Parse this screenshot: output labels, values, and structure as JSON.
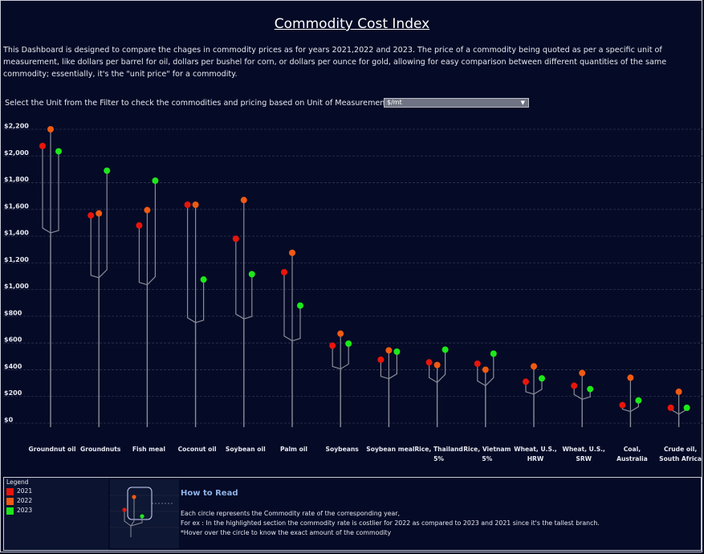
{
  "page": {
    "title": "Commodity Cost Index",
    "description": "This Dashboard is designed to compare the chages in commodity prices as for years  2021,2022 and 2023. The price of a commodity being quoted as per a specific unit of measurement, like dollars per barrel for oil, dollars per bushel for corn, or dollars per ounce for gold, allowing for easy comparison between different quantities of the same commodity; essentially, it's the \"unit price\" for a commodity.",
    "filter_label": "Select the Unit from the Filter to check the commodities and pricing based on Unit of Measurement",
    "unit_filter": {
      "selected": "$/mt"
    }
  },
  "colors": {
    "2021": "#e8150b",
    "2022": "#f05a12",
    "2023": "#1de81a",
    "branch": "#8a8d98",
    "grid": "#2f3550",
    "background": "#050a26"
  },
  "chart_data": {
    "type": "scatter",
    "categories": [
      "Groundnut oil",
      "Groundnuts",
      "Fish meal",
      "Coconut oil",
      "Soybean oil",
      "Palm oil",
      "Soybeans",
      "Soybean meal",
      "Rice, Thailand 5%",
      "Rice, Vietnam 5%",
      "Wheat, U.S., HRW",
      "Wheat, U.S., SRW",
      "Coal, Australia",
      "Crude oil, South Africa"
    ],
    "category_lines": [
      [
        "Groundnut oil"
      ],
      [
        "Groundnuts"
      ],
      [
        "Fish meal"
      ],
      [
        "Coconut oil"
      ],
      [
        "Soybean oil"
      ],
      [
        "Palm oil"
      ],
      [
        "Soybeans"
      ],
      [
        "Soybean meal"
      ],
      [
        "Rice, Thailand",
        "5%"
      ],
      [
        "Rice, Vietnam",
        "5%"
      ],
      [
        "Wheat, U.S.,",
        "HRW"
      ],
      [
        "Wheat, U.S.,",
        "SRW"
      ],
      [
        "Coal,",
        "Australia"
      ],
      [
        "Crude oil,",
        "South Africa"
      ]
    ],
    "series": [
      {
        "name": "2021",
        "values": [
          2075,
          1555,
          1480,
          1635,
          1380,
          1130,
          580,
          475,
          455,
          445,
          310,
          280,
          135,
          115
        ]
      },
      {
        "name": "2022",
        "values": [
          2200,
          1570,
          1595,
          1635,
          1670,
          1275,
          670,
          545,
          435,
          400,
          425,
          375,
          340,
          235
        ]
      },
      {
        "name": "2023",
        "values": [
          2035,
          1890,
          1815,
          1075,
          1115,
          880,
          595,
          535,
          550,
          520,
          335,
          255,
          170,
          115
        ]
      }
    ],
    "y_ticks": [
      "$0",
      "$200",
      "$400",
      "$600",
      "$800",
      "$1,000",
      "$1,200",
      "$1,400",
      "$1,600",
      "$1,800",
      "$2,000",
      "$2,200"
    ],
    "ylim": [
      0,
      2200
    ],
    "grid": true
  },
  "legend": {
    "title": "Legend",
    "items": [
      {
        "label": "2021",
        "color": "#e8150b"
      },
      {
        "label": "2022",
        "color": "#f05a12"
      },
      {
        "label": "2023",
        "color": "#1de81a"
      }
    ]
  },
  "how_to_read": {
    "title": "How to Read",
    "lines": [
      "Each circle represents the Commodity rate of the corresponding year,",
      "For ex : In the highlighted section the commodity rate is costlier for 2022 as compared to 2023 and 2021 since it's the tallest branch.",
      "*Hover over the circle to know the exact amount of the commodity"
    ]
  }
}
